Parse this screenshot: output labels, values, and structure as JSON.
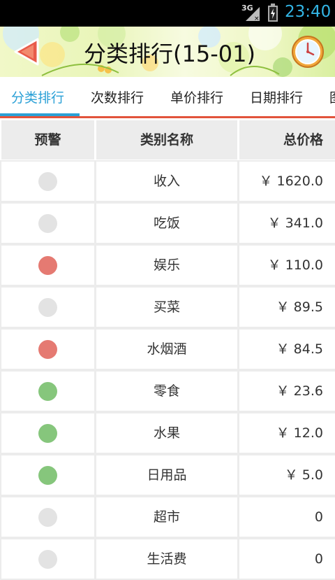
{
  "status_bar": {
    "network": "3G",
    "time": "23:40",
    "time_color": "#33b5e5"
  },
  "header": {
    "title": "分类排行(15-01)",
    "back_icon": "back-arrow-icon",
    "clock_icon": "clock-icon"
  },
  "tabs": [
    {
      "label": "分类排行",
      "active": true
    },
    {
      "label": "次数排行",
      "active": false
    },
    {
      "label": "单价排行",
      "active": false
    },
    {
      "label": "日期排行",
      "active": false
    },
    {
      "label": "图",
      "active": false
    }
  ],
  "accent_color": "#2aa0d6",
  "divider_color": "#e2533c",
  "table": {
    "headers": [
      "预警",
      "类别名称",
      "总价格"
    ],
    "status_colors": {
      "gray": "#e3e3e3",
      "red": "#e57a72",
      "green": "#86c67c"
    },
    "rows": [
      {
        "status": "gray",
        "name": "收入",
        "price": "￥ 1620.0"
      },
      {
        "status": "gray",
        "name": "吃饭",
        "price": "￥ 341.0"
      },
      {
        "status": "red",
        "name": "娱乐",
        "price": "￥ 110.0"
      },
      {
        "status": "gray",
        "name": "买菜",
        "price": "￥ 89.5"
      },
      {
        "status": "red",
        "name": "水烟酒",
        "price": "￥ 84.5"
      },
      {
        "status": "green",
        "name": "零食",
        "price": "￥ 23.6"
      },
      {
        "status": "green",
        "name": "水果",
        "price": "￥ 12.0"
      },
      {
        "status": "green",
        "name": "日用品",
        "price": "￥ 5.0"
      },
      {
        "status": "gray",
        "name": "超市",
        "price": "0"
      },
      {
        "status": "gray",
        "name": "生活费",
        "price": "0"
      }
    ]
  }
}
